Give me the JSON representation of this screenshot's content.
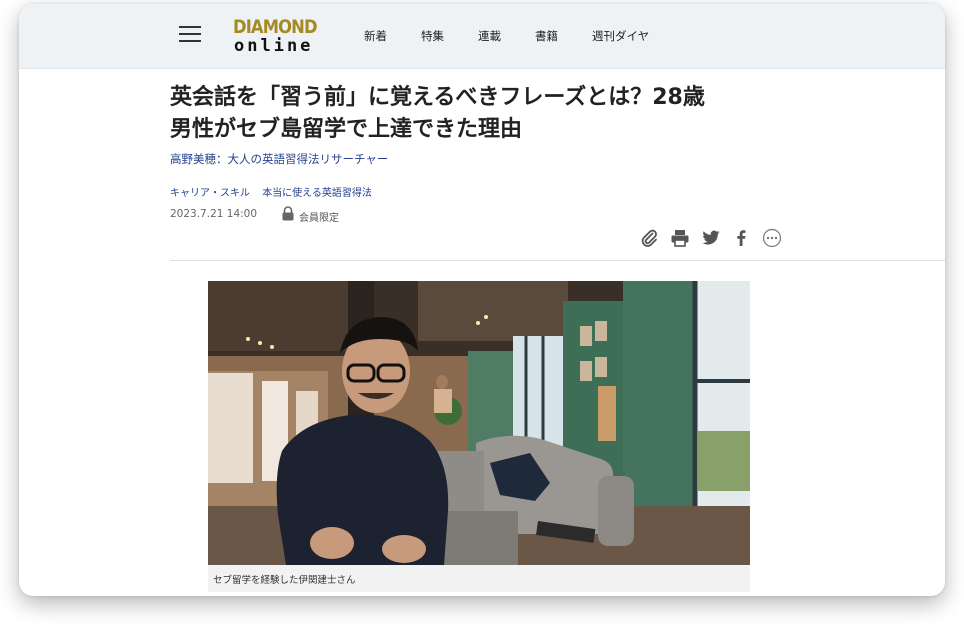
{
  "header": {
    "logo_line1": "DIAMOND",
    "logo_line2": "online",
    "nav": [
      "新着",
      "特集",
      "連載",
      "書籍",
      "週刊ダイヤ"
    ]
  },
  "article": {
    "title_line1": "英会話を「習う前」に覚えるべきフレーズとは？28歳",
    "title_line2": "男性がセブ島留学で上達できた理由",
    "author": "高野美穂：大人の英語習得法リサーチャー",
    "categories": [
      "キャリア・スキル",
      "本当に使える英語習得法"
    ],
    "date": "2023.7.21 14:00",
    "members_only": "会員限定",
    "share_icons": [
      "clip-icon",
      "print-icon",
      "twitter-icon",
      "facebook-icon",
      "more-icon"
    ],
    "photo_caption": "セブ留学を経験した伊関建士さん"
  },
  "colors": {
    "logo_gold": "#a58a22",
    "link_blue": "#26418f",
    "header_bg": "#eef2f5"
  }
}
